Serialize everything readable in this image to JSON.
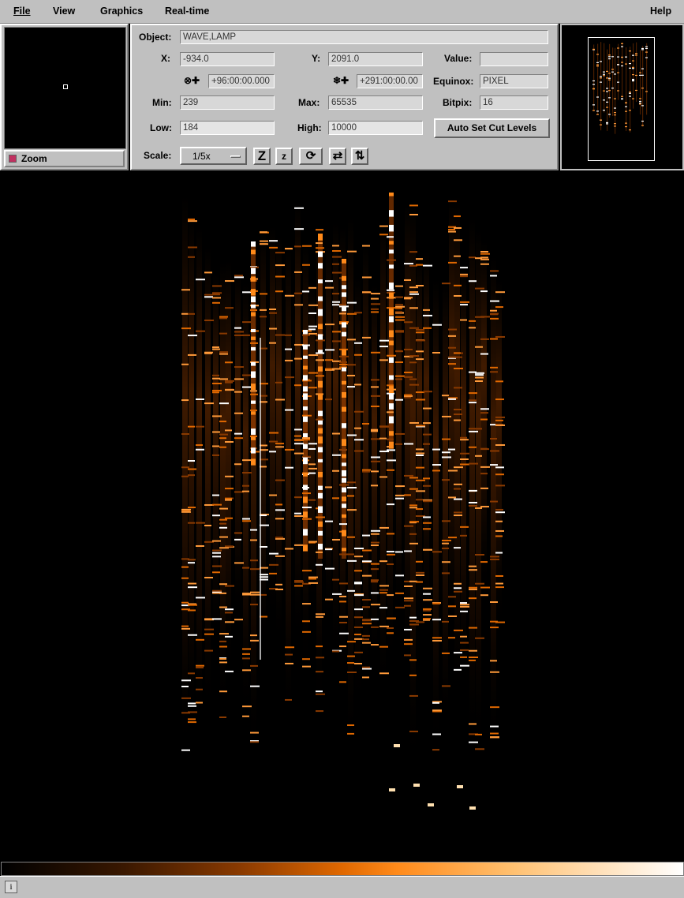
{
  "menu": {
    "file": "File",
    "view": "View",
    "graphics": "Graphics",
    "realtime": "Real-time",
    "help": "Help"
  },
  "zoom": {
    "label": "Zoom"
  },
  "info": {
    "object_label": "Object:",
    "object_value": "WAVE,LAMP",
    "x_label": "X:",
    "x_value": "-934.0",
    "y_label": "Y:",
    "y_value": "2091.0",
    "value_label": "Value:",
    "value_value": "",
    "ra_value": "+96:00:00.000",
    "dec_value": "+291:00:00.00",
    "equinox_label": "Equinox:",
    "equinox_value": "PIXEL",
    "min_label": "Min:",
    "min_value": "239",
    "max_label": "Max:",
    "max_value": "65535",
    "bitpix_label": "Bitpix:",
    "bitpix_value": "16",
    "low_label": "Low:",
    "low_value": "184",
    "high_label": "High:",
    "high_value": "10000",
    "auto_cut_label": "Auto Set Cut Levels",
    "scale_label": "Scale:",
    "scale_value": "1/5x"
  },
  "icons": {
    "ra": "ra-wcs-icon",
    "dec": "dec-wcs-icon",
    "zoom_in": "zoom-in-icon",
    "zoom_out": "zoom-out-icon",
    "rotate": "rotate-icon",
    "flip_x": "flip-x-icon",
    "flip_y": "flip-y-icon",
    "info": "info-icon"
  },
  "colors": {
    "panel": "#c0c0c0",
    "spectrum_orange": "#e06800",
    "spectrum_white": "#ffffff"
  }
}
